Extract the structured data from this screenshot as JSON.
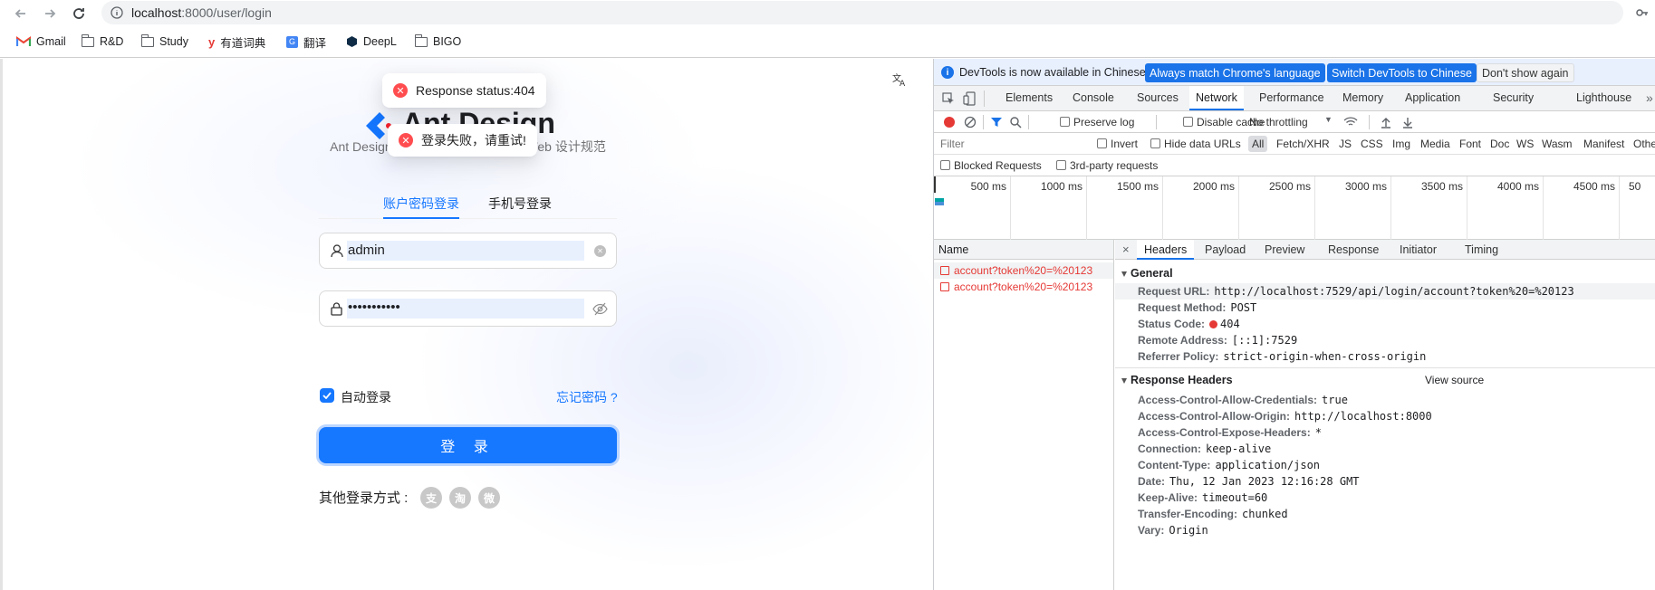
{
  "browser": {
    "url_host": "localhost",
    "url_rest": ":8000/user/login",
    "bookmarks": [
      {
        "label": "Gmail",
        "icon": "gmail-icon"
      },
      {
        "label": "R&D",
        "icon": "folder-icon"
      },
      {
        "label": "Study",
        "icon": "folder-icon"
      },
      {
        "label": "有道词典",
        "icon": "youdao-icon"
      },
      {
        "label": "翻译",
        "icon": "translate-icon"
      },
      {
        "label": "DeepL",
        "icon": "deepl-icon"
      },
      {
        "label": "BIGO",
        "icon": "folder-icon"
      }
    ]
  },
  "page": {
    "toast_404": "Response status:404",
    "toast_login_failed": "登录失败，请重试!",
    "title": "Ant Design",
    "subtitle": "Ant Design 是西湖区最具影响力的 Web 设计规范",
    "tabs": [
      "账户密码登录",
      "手机号登录"
    ],
    "username_value": "admin",
    "password_value": "•••••••••••",
    "auto_login_label": "自动登录",
    "forgot_password": "忘记密码 ?",
    "login_button": "登 录",
    "other_login": "其他登录方式 :",
    "social_icons": [
      "支",
      "淘",
      "微"
    ],
    "accent_color": "#1677ff"
  },
  "devtools": {
    "banner": {
      "text": "DevTools is now available in Chinese!",
      "btn_match": "Always match Chrome's language",
      "btn_switch": "Switch DevTools to Chinese",
      "btn_dismiss": "Don't show again"
    },
    "tabs": [
      "Elements",
      "Console",
      "Sources",
      "Network",
      "Performance",
      "Memory",
      "Application",
      "Security",
      "Lighthouse"
    ],
    "active_tab": "Network",
    "toolbar": {
      "preserve_log": "Preserve log",
      "disable_cache": "Disable cache",
      "throttling": "No throttling"
    },
    "filter": {
      "placeholder": "Filter",
      "invert": "Invert",
      "hide_data_urls": "Hide data URLs",
      "types": [
        "All",
        "Fetch/XHR",
        "JS",
        "CSS",
        "Img",
        "Media",
        "Font",
        "Doc",
        "WS",
        "Wasm",
        "Manifest",
        "Othe"
      ],
      "blocked_requests": "Blocked Requests",
      "third_party": "3rd-party requests"
    },
    "timeline_ticks": [
      "500 ms",
      "1000 ms",
      "1500 ms",
      "2000 ms",
      "2500 ms",
      "3000 ms",
      "3500 ms",
      "4000 ms",
      "4500 ms",
      "50"
    ],
    "name_header": "Name",
    "requests": [
      "account?token%20=%20123",
      "account?token%20=%20123"
    ],
    "detail_tabs": [
      "Headers",
      "Payload",
      "Preview",
      "Response",
      "Initiator",
      "Timing"
    ],
    "general_title": "General",
    "general": [
      {
        "k": "Request URL:",
        "v": "http://localhost:7529/api/login/account?token%20=%20123"
      },
      {
        "k": "Request Method:",
        "v": "POST"
      },
      {
        "k": "Status Code:",
        "v": "404"
      },
      {
        "k": "Remote Address:",
        "v": "[::1]:7529"
      },
      {
        "k": "Referrer Policy:",
        "v": "strict-origin-when-cross-origin"
      }
    ],
    "response_headers_title": "Response Headers",
    "view_source": "View source",
    "response_headers": [
      {
        "k": "Access-Control-Allow-Credentials:",
        "v": "true"
      },
      {
        "k": "Access-Control-Allow-Origin:",
        "v": "http://localhost:8000"
      },
      {
        "k": "Access-Control-Expose-Headers:",
        "v": "*"
      },
      {
        "k": "Connection:",
        "v": "keep-alive"
      },
      {
        "k": "Content-Type:",
        "v": "application/json"
      },
      {
        "k": "Date:",
        "v": "Thu, 12 Jan 2023 12:16:28 GMT"
      },
      {
        "k": "Keep-Alive:",
        "v": "timeout=60"
      },
      {
        "k": "Transfer-Encoding:",
        "v": "chunked"
      },
      {
        "k": "Vary:",
        "v": "Origin"
      }
    ]
  }
}
